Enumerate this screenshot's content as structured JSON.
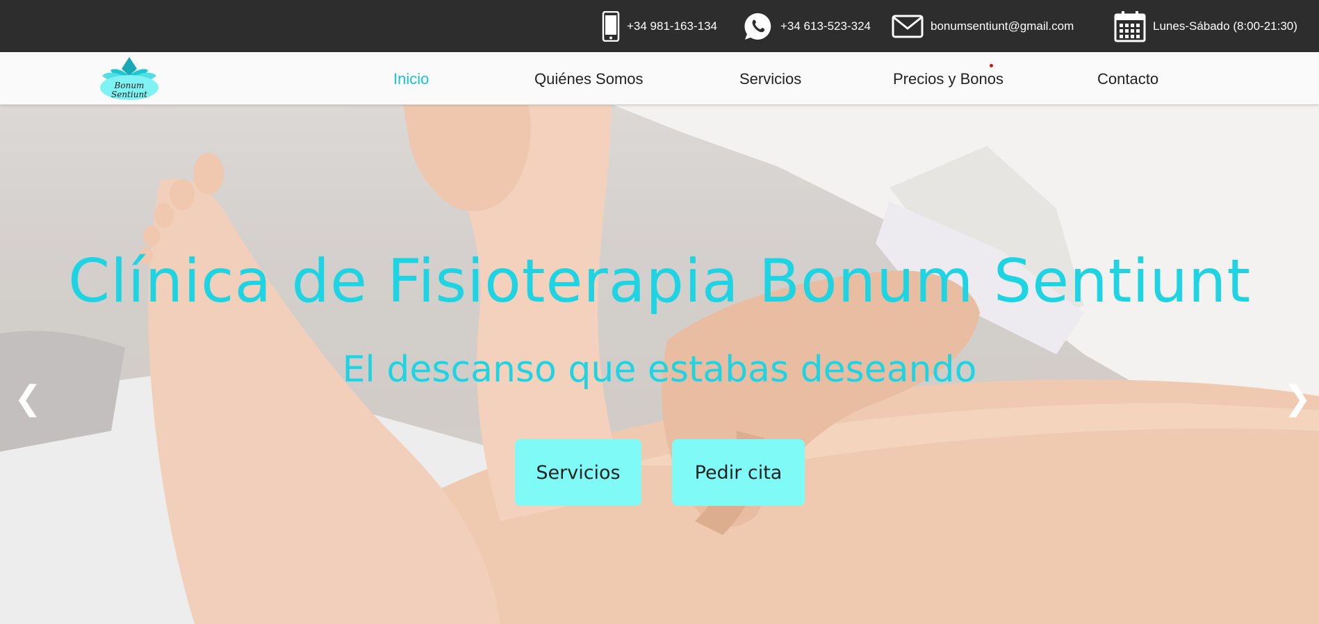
{
  "topbar": {
    "phone": {
      "icon": "mobile-phone-icon",
      "text": "+34 981-163-134"
    },
    "whatsapp": {
      "icon": "whatsapp-icon",
      "text": "+34 613-523-324"
    },
    "email": {
      "icon": "envelope-icon",
      "text": "bonumsentiunt@gmail.com"
    },
    "hours": {
      "icon": "calendar-icon",
      "text": "Lunes-Sábado (8:00-21:30)"
    }
  },
  "logo": {
    "line1": "Bonum",
    "line2": "Sentiunt",
    "icon": "lotus-logo"
  },
  "nav": {
    "items": [
      {
        "label": "Inicio",
        "active": true
      },
      {
        "label": "Quiénes Somos",
        "active": false
      },
      {
        "label": "Servicios",
        "active": false
      },
      {
        "label": "Precios y Bonos",
        "active": false
      },
      {
        "label": "Contacto",
        "active": false
      }
    ]
  },
  "hero": {
    "title": "Clínica de Fisioterapia Bonum Sentiunt",
    "subtitle": "El descanso que estabas deseando",
    "buttons": [
      {
        "label": "Servicios"
      },
      {
        "label": "Pedir cita"
      }
    ],
    "prev_arrow": "❮",
    "next_arrow": "❯"
  },
  "colors": {
    "accent": "#1ed4e2",
    "button_bg": "#7ffaf6",
    "topbar_bg": "#2d2d2d",
    "nav_bg": "#fafafa"
  }
}
